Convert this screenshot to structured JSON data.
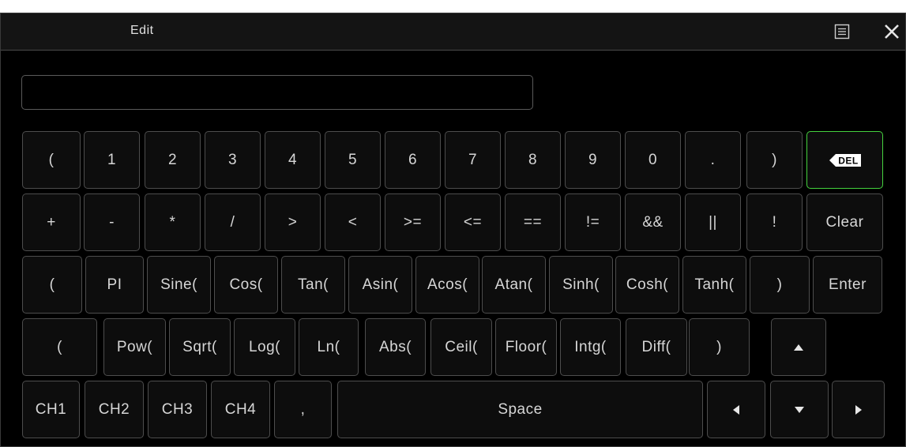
{
  "window": {
    "title": "Edit",
    "menu_icon": "list-menu-icon",
    "close_icon": "close-icon"
  },
  "input": {
    "value": "",
    "placeholder": ""
  },
  "keyboard": {
    "rows": [
      {
        "keys": [
          {
            "id": "paren-open-1",
            "label": "("
          },
          {
            "id": "digit-1",
            "label": "1"
          },
          {
            "id": "digit-2",
            "label": "2"
          },
          {
            "id": "digit-3",
            "label": "3"
          },
          {
            "id": "digit-4",
            "label": "4"
          },
          {
            "id": "digit-5",
            "label": "5"
          },
          {
            "id": "digit-6",
            "label": "6"
          },
          {
            "id": "digit-7",
            "label": "7"
          },
          {
            "id": "digit-8",
            "label": "8"
          },
          {
            "id": "digit-9",
            "label": "9"
          },
          {
            "id": "digit-0",
            "label": "0"
          },
          {
            "id": "period",
            "label": "."
          },
          {
            "id": "paren-close-1",
            "label": ")"
          },
          {
            "id": "delete",
            "label": "DEL",
            "icon": "delete-backspace-icon",
            "accent": "#45d23e"
          }
        ]
      },
      {
        "keys": [
          {
            "id": "plus",
            "label": "+"
          },
          {
            "id": "minus",
            "label": "-"
          },
          {
            "id": "multiply",
            "label": "*"
          },
          {
            "id": "divide",
            "label": "/"
          },
          {
            "id": "greater",
            "label": ">"
          },
          {
            "id": "less",
            "label": "<"
          },
          {
            "id": "greater-equal",
            "label": ">="
          },
          {
            "id": "less-equal",
            "label": "<="
          },
          {
            "id": "equal",
            "label": "=="
          },
          {
            "id": "not-equal",
            "label": "!="
          },
          {
            "id": "and",
            "label": "&&"
          },
          {
            "id": "or",
            "label": "||"
          },
          {
            "id": "not",
            "label": "!"
          },
          {
            "id": "clear",
            "label": "Clear"
          }
        ]
      },
      {
        "keys": [
          {
            "id": "paren-open-3",
            "label": "("
          },
          {
            "id": "pi",
            "label": "PI"
          },
          {
            "id": "sine",
            "label": "Sine("
          },
          {
            "id": "cos",
            "label": "Cos("
          },
          {
            "id": "tan",
            "label": "Tan("
          },
          {
            "id": "asin",
            "label": "Asin("
          },
          {
            "id": "acos",
            "label": "Acos("
          },
          {
            "id": "atan",
            "label": "Atan("
          },
          {
            "id": "sinh",
            "label": "Sinh("
          },
          {
            "id": "cosh",
            "label": "Cosh("
          },
          {
            "id": "tanh",
            "label": "Tanh("
          },
          {
            "id": "paren-close-3",
            "label": ")"
          },
          {
            "id": "enter",
            "label": "Enter"
          }
        ]
      },
      {
        "keys": [
          {
            "id": "paren-open-4",
            "label": "("
          },
          {
            "id": "pow",
            "label": "Pow("
          },
          {
            "id": "sqrt",
            "label": "Sqrt("
          },
          {
            "id": "log",
            "label": "Log("
          },
          {
            "id": "ln",
            "label": "Ln("
          },
          {
            "id": "abs",
            "label": "Abs("
          },
          {
            "id": "ceil",
            "label": "Ceil("
          },
          {
            "id": "floor",
            "label": "Floor("
          },
          {
            "id": "intg",
            "label": "Intg("
          },
          {
            "id": "diff",
            "label": "Diff("
          },
          {
            "id": "paren-close-4",
            "label": ")"
          },
          {
            "id": "arrow-up",
            "label": "",
            "icon": "arrow-up-icon"
          }
        ]
      },
      {
        "keys": [
          {
            "id": "ch1",
            "label": "CH1"
          },
          {
            "id": "ch2",
            "label": "CH2"
          },
          {
            "id": "ch3",
            "label": "CH3"
          },
          {
            "id": "ch4",
            "label": "CH4"
          },
          {
            "id": "comma",
            "label": ","
          },
          {
            "id": "space",
            "label": "Space"
          },
          {
            "id": "arrow-left",
            "label": "",
            "icon": "arrow-left-icon"
          },
          {
            "id": "arrow-down",
            "label": "",
            "icon": "arrow-down-icon"
          },
          {
            "id": "arrow-right",
            "label": "",
            "icon": "arrow-right-icon"
          }
        ]
      }
    ]
  },
  "colors": {
    "background": "#000000",
    "key_border": "#4d4d4d",
    "key_text": "#d6d6d6",
    "accent_green": "#45d23e"
  }
}
